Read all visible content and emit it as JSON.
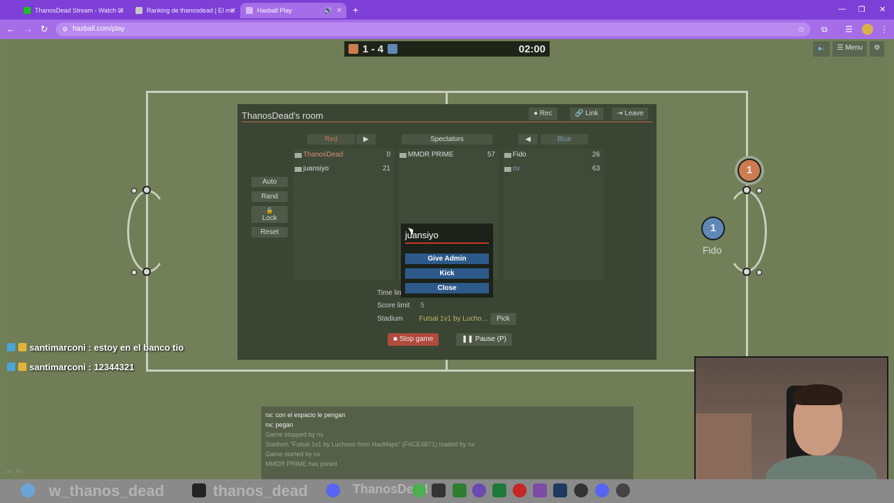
{
  "browser": {
    "tabs": [
      {
        "label": "ThanosDead Stream - Watch Li",
        "color": "#18c51c"
      },
      {
        "label": "Ranking de thanosdead | El me",
        "color": "#c8c8c8"
      },
      {
        "label": "Haxball Play",
        "color": "#d8b8ff"
      }
    ],
    "url": "haxball.com/play"
  },
  "game": {
    "score": "1 - 4",
    "time": "02:00",
    "menu_label": "Menu",
    "red_player_number": "1",
    "blue_player_number": "1",
    "blue_player_name": "Fido"
  },
  "room": {
    "title": "ThanosDead's room",
    "buttons": {
      "rec": "Rec",
      "link": "Link",
      "leave": "Leave"
    },
    "teams": {
      "red": "Red",
      "spectators": "Spectators",
      "blue": "Blue"
    },
    "red_players": [
      {
        "name": "ThanosDead",
        "value": "0"
      },
      {
        "name": "juansiyo",
        "value": "21"
      }
    ],
    "spectators": [
      {
        "name": "MMDR PRIME",
        "value": "57"
      }
    ],
    "blue_players": [
      {
        "name": "Fido",
        "value": "26"
      },
      {
        "name": "nx",
        "value": "63"
      }
    ],
    "side_buttons": {
      "auto": "Auto",
      "rand": "Rand",
      "lock": "Lock",
      "reset": "Reset"
    },
    "settings": {
      "time_limit_label": "Time limi",
      "score_limit_label": "Score limit",
      "score_limit_value": "5",
      "stadium_label": "Stadium",
      "stadium_value": "Futsal 1v1 by Lucho...",
      "pick_label": "Pick"
    },
    "stop_game": "Stop game",
    "pause": "Pause (P)"
  },
  "popup": {
    "title": "juansiyo",
    "give_admin": "Give Admin",
    "kick": "Kick",
    "close": "Close"
  },
  "chat": [
    {
      "text": "nx: con el espacio le pengan",
      "type": "msg"
    },
    {
      "text": "nx: pegan",
      "type": "msg"
    },
    {
      "text": "Game stopped by nx",
      "type": "notice"
    },
    {
      "text": "Stadium \"Futsal 1v1 by Luchooo from HaxMaps\" (F6CE4B71) loaded by nx",
      "type": "notice"
    },
    {
      "text": "Game started by nx",
      "type": "notice"
    },
    {
      "text": "MMDR PRIME has joined",
      "type": "notice"
    }
  ],
  "overlay_chat": [
    {
      "text": "santimarconi : estoy en el banco tio"
    },
    {
      "text": "santimarconi : 12344321"
    }
  ],
  "overlay_brand": {
    "left": "w_thanos_dead",
    "right": "thanos_dead",
    "center": "ThanosDead"
  },
  "ps_label": "ps: 60",
  "colors": {
    "red_team": "#cc7c4f",
    "blue_team": "#5f88b7",
    "accent": "#c46e48"
  }
}
